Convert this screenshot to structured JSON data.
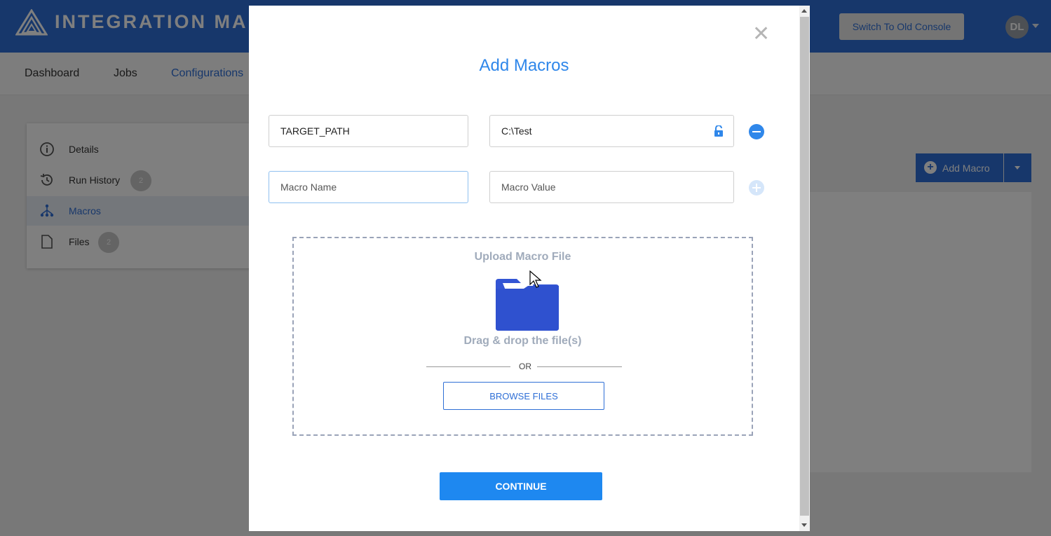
{
  "app": {
    "title": "INTEGRATION MANA",
    "switch_console_label": "Switch To Old Console",
    "avatar_initials": "DL",
    "brand_color": "#2f6fd6"
  },
  "nav": {
    "tabs": [
      {
        "label": "Dashboard"
      },
      {
        "label": "Jobs"
      },
      {
        "label": "Configurations",
        "active": true
      }
    ]
  },
  "sidebar": {
    "items": [
      {
        "label": "Details",
        "icon": "info-icon"
      },
      {
        "label": "Run History",
        "icon": "history-icon",
        "count": "2"
      },
      {
        "label": "Macros",
        "icon": "macros-icon",
        "active": true
      },
      {
        "label": "Files",
        "icon": "file-icon",
        "count": "2"
      }
    ]
  },
  "toolbar": {
    "add_macro_label": "Add Macro"
  },
  "modal": {
    "title": "Add Macros",
    "close_icon": "close-icon",
    "rows": [
      {
        "name_value": "TARGET_PATH",
        "value_value": "C:\\Test",
        "lock_icon": "unlock-icon",
        "action_icon": "remove-icon"
      },
      {
        "name_placeholder": "Macro Name",
        "value_placeholder": "Macro Value",
        "action_icon": "add-icon"
      }
    ],
    "upload": {
      "title": "Upload Macro File",
      "drag_text": "Drag & drop the file(s)",
      "or_text": "OR",
      "browse_label": "BROWSE FILES"
    },
    "continue_label": "CONTINUE",
    "accent_color": "#2f87ea"
  }
}
